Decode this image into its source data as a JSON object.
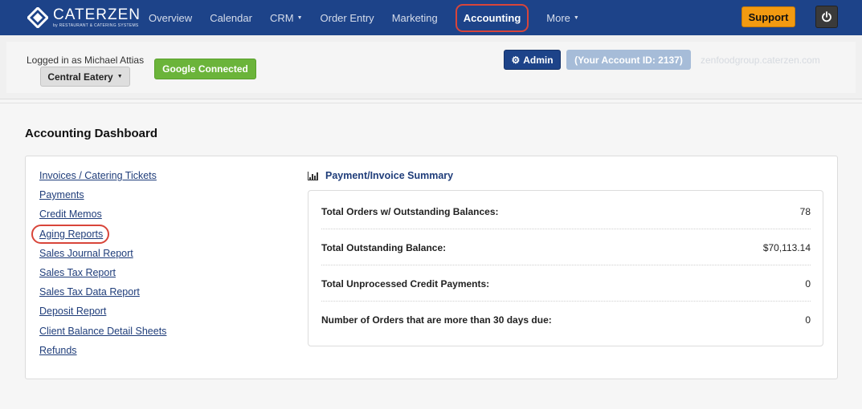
{
  "navbar": {
    "logo_name": "CATERZEN",
    "logo_tag": "by RESTAURANT & CATERING SYSTEMS",
    "items": [
      {
        "label": "Overview",
        "caret": false
      },
      {
        "label": "Calendar",
        "caret": false
      },
      {
        "label": "CRM",
        "caret": true
      },
      {
        "label": "Order Entry",
        "caret": false
      },
      {
        "label": "Marketing",
        "caret": false
      },
      {
        "label": "Accounting",
        "caret": false,
        "active": true
      },
      {
        "label": "More",
        "caret": true
      }
    ],
    "support_label": "Support",
    "power_icon": "power-icon"
  },
  "account": {
    "logged_in": "Logged in as Michael Attias",
    "store": "Central Eatery",
    "google": "Google Connected",
    "admin": "Admin",
    "account_id": "(Your Account ID: 2137)",
    "faded_url": "zenfoodgroup.caterzen.com"
  },
  "page": {
    "title": "Accounting Dashboard"
  },
  "links": [
    "Invoices / Catering Tickets",
    "Payments",
    "Credit Memos",
    "Aging Reports",
    "Sales Journal Report",
    "Sales Tax Report",
    "Sales Tax Data Report",
    "Deposit Report",
    "Client Balance Detail Sheets",
    "Refunds"
  ],
  "summary": {
    "title": "Payment/Invoice Summary",
    "rows": [
      {
        "label": "Total Orders w/ Outstanding Balances:",
        "value": "78"
      },
      {
        "label": "Total Outstanding Balance:",
        "value": "$70,113.14"
      },
      {
        "label": "Total Unprocessed Credit Payments:",
        "value": "0"
      },
      {
        "label": "Number of Orders that are more than 30 days due:",
        "value": "0"
      }
    ]
  },
  "colors": {
    "navbar": "#1d4389",
    "highlight": "#d8453a",
    "support": "#f29a11",
    "google": "#6bb43a",
    "link": "#1f3d7a"
  }
}
